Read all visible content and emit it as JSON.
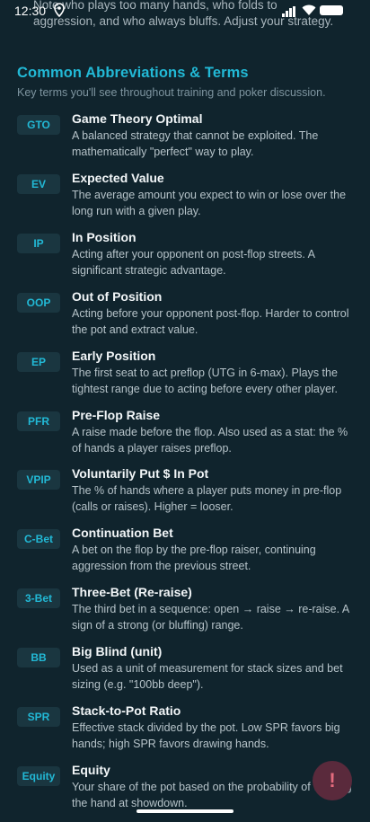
{
  "status_bar": {
    "time": "12:30"
  },
  "cutoff_text": "Note who plays too many hands, who folds to aggression, and who always bluffs. Adjust your strategy.",
  "section": {
    "title": "Common Abbreviations & Terms",
    "subtitle": "Key terms you'll see throughout training and poker discussion."
  },
  "terms": [
    {
      "abbr": "GTO",
      "title": "Game Theory Optimal",
      "desc": "A balanced strategy that cannot be exploited. The mathematically \"perfect\" way to play."
    },
    {
      "abbr": "EV",
      "title": "Expected Value",
      "desc": "The average amount you expect to win or lose over the long run with a given play."
    },
    {
      "abbr": "IP",
      "title": "In Position",
      "desc": "Acting after your opponent on post-flop streets. A significant strategic advantage."
    },
    {
      "abbr": "OOP",
      "title": "Out of Position",
      "desc": "Acting before your opponent post-flop. Harder to control the pot and extract value."
    },
    {
      "abbr": "EP",
      "title": "Early Position",
      "desc": "The first seat to act preflop (UTG in 6-max). Plays the tightest range due to acting before every other player."
    },
    {
      "abbr": "PFR",
      "title": "Pre-Flop Raise",
      "desc": "A raise made before the flop. Also used as a stat: the % of hands a player raises preflop."
    },
    {
      "abbr": "VPIP",
      "title": "Voluntarily Put $ In Pot",
      "desc": "The % of hands where a player puts money in pre-flop (calls or raises). Higher = looser."
    },
    {
      "abbr": "C-Bet",
      "title": "Continuation Bet",
      "desc": "A bet on the flop by the pre-flop raiser, continuing aggression from the previous street."
    },
    {
      "abbr": "3-Bet",
      "title": "Three-Bet (Re-raise)",
      "desc": "The third bet in a sequence: open → raise → re-raise. A sign of a strong (or bluffing) range."
    },
    {
      "abbr": "BB",
      "title": "Big Blind (unit)",
      "desc": "Used as a unit of measurement for stack sizes and bet sizing (e.g. \"100bb deep\")."
    },
    {
      "abbr": "SPR",
      "title": "Stack-to-Pot Ratio",
      "desc": "Effective stack divided by the pot. Low SPR favors big hands; high SPR favors drawing hands."
    },
    {
      "abbr": "Equity",
      "title": "Equity",
      "desc": "Your share of the pot based on the probability of winning the hand at showdown."
    }
  ],
  "fab": {
    "label": "!",
    "icon": "alert-icon"
  }
}
